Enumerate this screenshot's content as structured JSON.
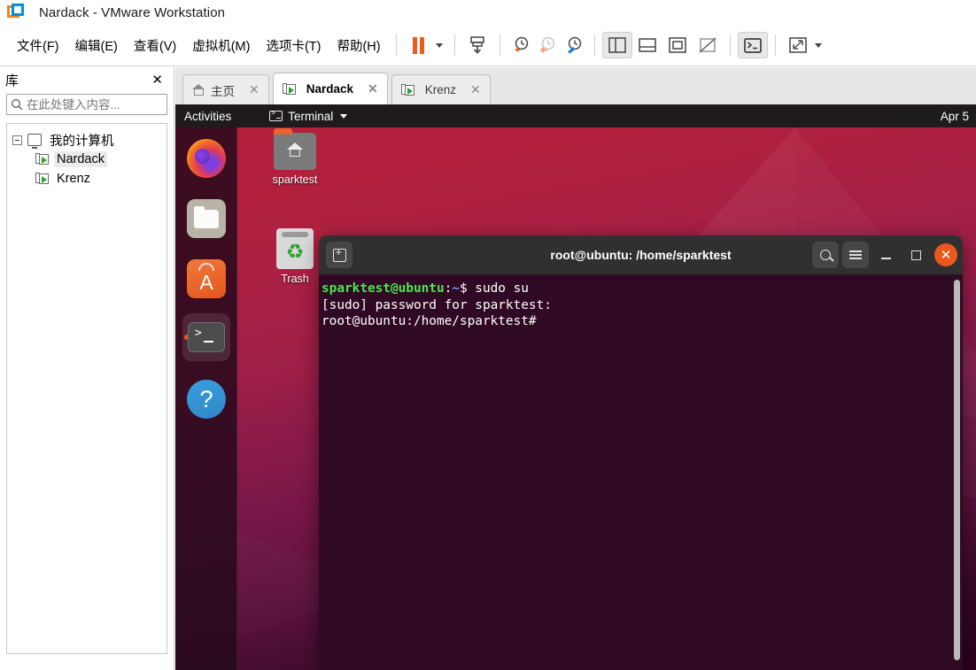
{
  "window": {
    "title": "Nardack - VMware Workstation",
    "logo_icon": "vmware-logo-icon"
  },
  "menubar": {
    "items": [
      {
        "label": "文件(F)",
        "name": "menu-file"
      },
      {
        "label": "编辑(E)",
        "name": "menu-edit"
      },
      {
        "label": "查看(V)",
        "name": "menu-view"
      },
      {
        "label": "虚拟机(M)",
        "name": "menu-vm"
      },
      {
        "label": "选项卡(T)",
        "name": "menu-tabs"
      },
      {
        "label": "帮助(H)",
        "name": "menu-help"
      }
    ]
  },
  "toolbar": {
    "buttons": [
      {
        "name": "suspend-button",
        "icon": "pause-icon"
      },
      {
        "name": "suspend-dropdown",
        "icon": "chevron-down-icon"
      },
      {
        "name": "power-button",
        "icon": "power-stack-icon"
      },
      {
        "name": "snapshot-take-button",
        "icon": "snapshot-add-icon"
      },
      {
        "name": "snapshot-revert-button",
        "icon": "snapshot-revert-icon"
      },
      {
        "name": "snapshot-manager-button",
        "icon": "snapshot-manager-icon"
      },
      {
        "name": "show-library-button",
        "icon": "panel-left-icon"
      },
      {
        "name": "show-thumbnail-bar-button",
        "icon": "panel-bottom-icon"
      },
      {
        "name": "fullscreen-button",
        "icon": "fullscreen-icon"
      },
      {
        "name": "unity-mode-button",
        "icon": "unity-off-icon"
      },
      {
        "name": "console-button",
        "icon": "terminal-icon"
      },
      {
        "name": "stretch-button",
        "icon": "expand-arrows-icon"
      },
      {
        "name": "stretch-dropdown",
        "icon": "chevron-down-icon"
      }
    ]
  },
  "library": {
    "title": "库",
    "close_label": "✕",
    "search": {
      "placeholder": "在此处键入内容...",
      "value": "",
      "icon": "search-icon",
      "dropdown_icon": "chevron-down-icon"
    },
    "tree": {
      "root": {
        "label": "我的计算机",
        "icon": "monitor-icon",
        "expanded": true
      },
      "children": [
        {
          "label": "Nardack",
          "icon": "vm-icon",
          "selected": true
        },
        {
          "label": "Krenz",
          "icon": "vm-icon",
          "selected": false
        }
      ]
    }
  },
  "tabs": [
    {
      "label": "主页",
      "icon": "home-icon",
      "active": false,
      "close": "✕"
    },
    {
      "label": "Nardack",
      "icon": "vm-icon",
      "active": true,
      "close": "✕"
    },
    {
      "label": "Krenz",
      "icon": "vm-icon",
      "active": false,
      "close": "✕"
    }
  ],
  "guest": {
    "topbar": {
      "activities": "Activities",
      "app_name": "Terminal",
      "app_icon": "terminal-icon",
      "app_caret": "chevron-down-icon",
      "clock": "Apr 5"
    },
    "dock": [
      {
        "name": "dock-item-firefox",
        "icon": "firefox-icon",
        "running": false
      },
      {
        "name": "dock-item-files",
        "icon": "files-icon",
        "running": false
      },
      {
        "name": "dock-item-software",
        "icon": "ubuntu-software-icon",
        "running": false
      },
      {
        "name": "dock-item-terminal",
        "icon": "terminal-icon",
        "running": true
      },
      {
        "name": "dock-item-help",
        "icon": "help-icon",
        "running": false
      }
    ],
    "desktop_icons": [
      {
        "label": "sparktest",
        "icon": "home-folder-icon"
      },
      {
        "label": "Trash",
        "icon": "trash-icon"
      }
    ]
  },
  "terminal": {
    "title": "root@ubuntu: /home/sparktest",
    "new_tab_icon": "new-tab-icon",
    "search_icon": "search-icon",
    "menu_icon": "hamburger-menu-icon",
    "minimize_icon": "minimize-icon",
    "maximize_icon": "maximize-icon",
    "close_icon": "close-icon",
    "close_glyph": "✕",
    "lines": [
      {
        "prompt_user": "sparktest@ubuntu",
        "prompt_sep": ":",
        "prompt_path": "~",
        "prompt_tail": "$ ",
        "command": "sudo su"
      },
      {
        "plain": "[sudo] password for sparktest:"
      },
      {
        "plain": "root@ubuntu:/home/sparktest#"
      }
    ],
    "colors": {
      "background": "#300a24",
      "header": "#303030",
      "prompt_user": "#4ee24e",
      "prompt_path": "#6c9ef8",
      "close_button": "#e8591f"
    }
  }
}
